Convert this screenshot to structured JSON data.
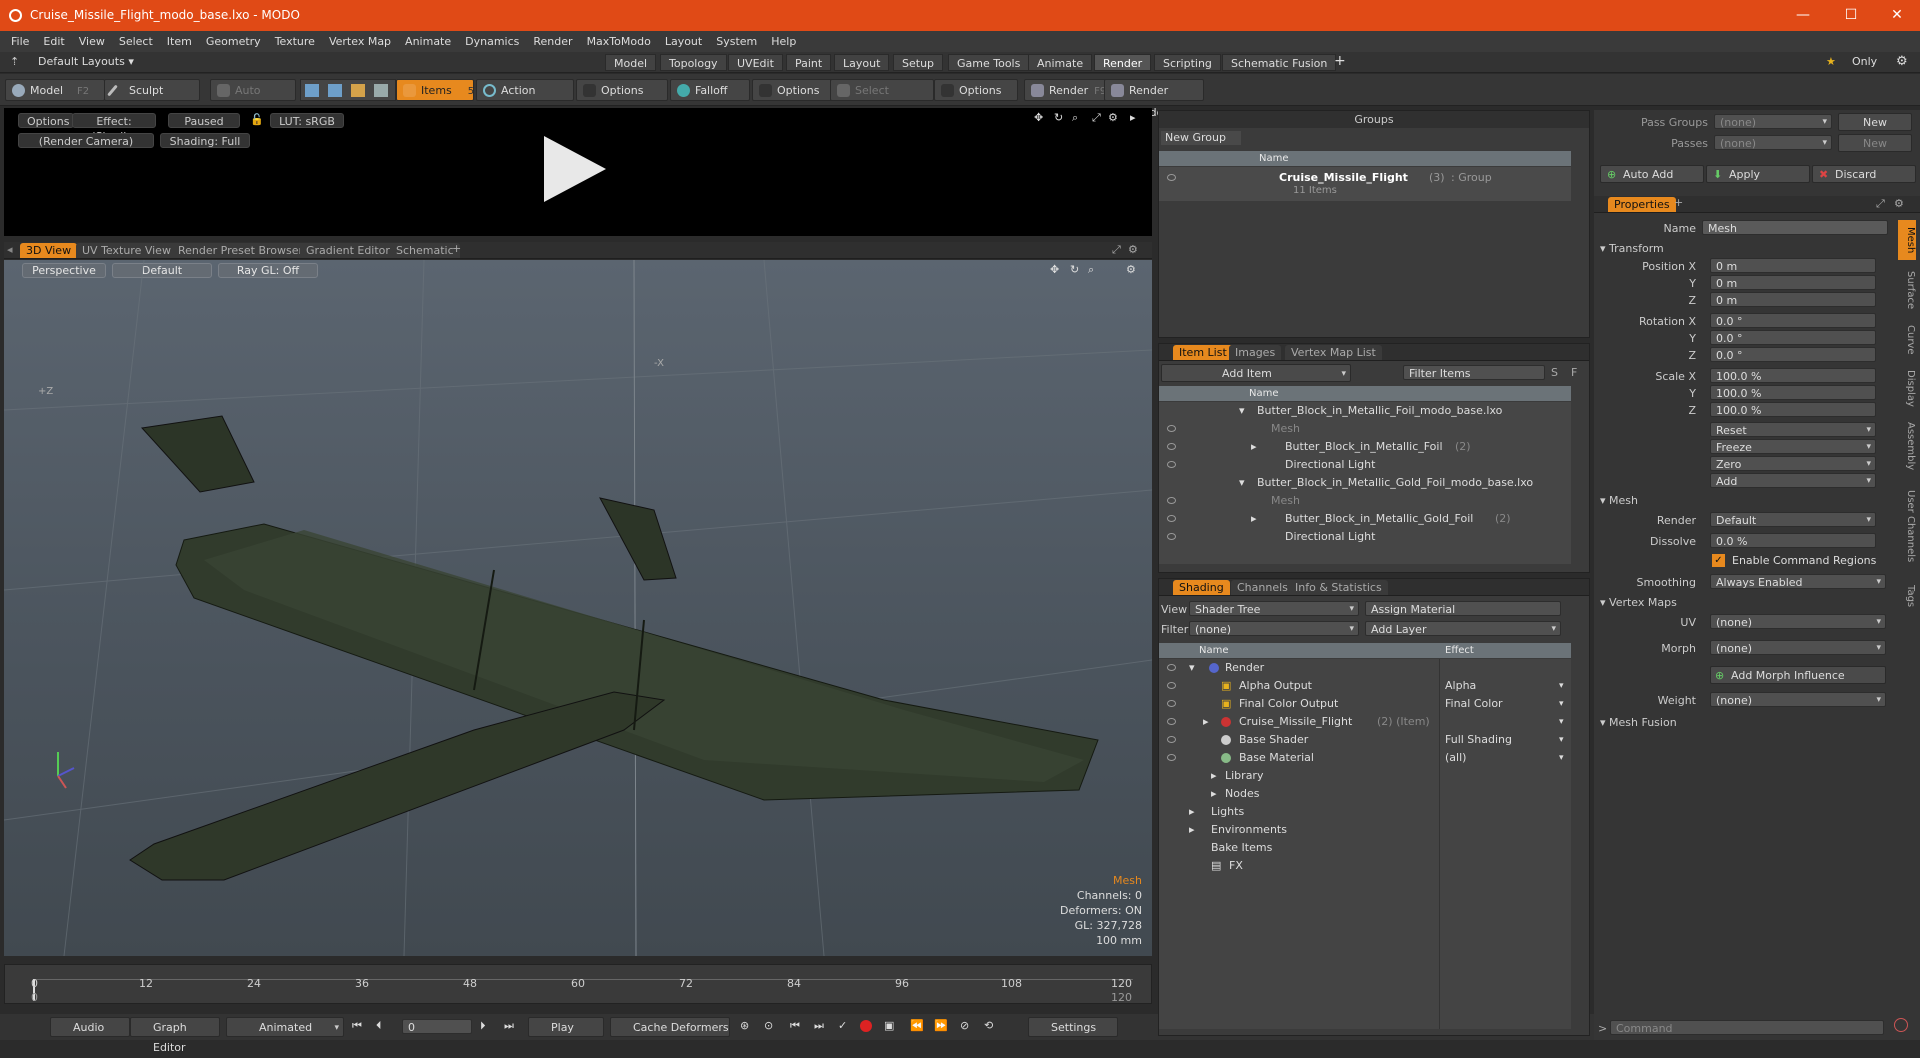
{
  "window": {
    "title": "Cruise_Missile_Flight_modo_base.lxo - MODO",
    "min": "—",
    "max": "☐",
    "close": "✕"
  },
  "menu": [
    "File",
    "Edit",
    "View",
    "Select",
    "Item",
    "Geometry",
    "Texture",
    "Vertex Map",
    "Animate",
    "Dynamics",
    "Render",
    "MaxToModo",
    "Layout",
    "System",
    "Help"
  ],
  "layout": {
    "dropdown": "Default Layouts",
    "tabs": [
      "Model",
      "Topology",
      "UVEdit",
      "Paint",
      "Layout",
      "Setup",
      "Game Tools",
      "Animate",
      "Render",
      "Scripting",
      "Schematic Fusion"
    ],
    "active": "Render",
    "add": "+",
    "only": "Only"
  },
  "toolbar": {
    "model": "Model",
    "model_key": "F2",
    "sculpt": "Sculpt",
    "auto_select": "Auto Select",
    "items": "Items",
    "items_key": "5",
    "action_center": "Action Center",
    "options1": "Options",
    "falloff": "Falloff",
    "options2": "Options",
    "select_through": "Select Through",
    "options3": "Options",
    "render": "Render",
    "render_key": "F9",
    "render_window": "Render Window"
  },
  "preview": {
    "options": "Options",
    "effect": "Effect: (Shadi...",
    "paused": "Paused",
    "lut": "LUT: sRGB",
    "camera": "(Render Camera)",
    "shading": "Shading: Full"
  },
  "viewtabs": [
    "3D View",
    "UV Texture View",
    "Render Preset Browser",
    "Gradient Editor",
    "Schematic"
  ],
  "viewport": {
    "perspective": "Perspective",
    "default": "Default",
    "raygl": "Ray GL: Off",
    "mesh": "Mesh",
    "channels": "Channels: 0",
    "deformers": "Deformers: ON",
    "gl": "GL: 327,728",
    "scale": "100 mm",
    "axis_z": "+Z",
    "axis_x": "-X"
  },
  "timeline": {
    "ticks": [
      "0",
      "12",
      "24",
      "36",
      "48",
      "60",
      "72",
      "84",
      "96",
      "108",
      "120"
    ],
    "end": "120",
    "start": "0"
  },
  "transport": {
    "audio": "Audio",
    "graph_editor": "Graph Editor",
    "animated": "Animated",
    "frame": "0",
    "play": "Play",
    "cache": "Cache Deformers",
    "settings": "Settings"
  },
  "groups": {
    "title": "Groups",
    "new_group": "New Group",
    "col_name": "Name",
    "group_name": "Cruise_Missile_Flight",
    "group_count": "(3)",
    "group_type": ": Group",
    "group_items": "11 Items"
  },
  "itemlist": {
    "tabs": [
      "Item List",
      "Images",
      "Vertex Map List"
    ],
    "add_item": "Add Item",
    "filter": "Filter Items",
    "s": "S",
    "f": "F",
    "col_name": "Name",
    "rows": [
      {
        "label": "Butter_Block_in_Metallic_Foil_modo_base.lxo",
        "extra": ""
      },
      {
        "label": "Mesh",
        "extra": ""
      },
      {
        "label": "Butter_Block_in_Metallic_Foil",
        "extra": "(2)"
      },
      {
        "label": "Directional Light",
        "extra": ""
      },
      {
        "label": "Butter_Block_in_Metallic_Gold_Foil_modo_base.lxo",
        "extra": ""
      },
      {
        "label": "Mesh",
        "extra": ""
      },
      {
        "label": "Butter_Block_in_Metallic_Gold_Foil",
        "extra": "(2)"
      },
      {
        "label": "Directional Light",
        "extra": ""
      }
    ]
  },
  "shading": {
    "tabs": [
      "Shading",
      "Channels",
      "Info & Statistics"
    ],
    "view_label": "View",
    "view": "Shader Tree",
    "assign": "Assign Material",
    "filter_label": "Filter",
    "filter": "(none)",
    "add_layer": "Add Layer",
    "col_name": "Name",
    "col_effect": "Effect",
    "rows": [
      {
        "label": "Render",
        "extra": "",
        "effect": ""
      },
      {
        "label": "Alpha Output",
        "extra": "",
        "effect": "Alpha"
      },
      {
        "label": "Final Color Output",
        "extra": "",
        "effect": "Final Color"
      },
      {
        "label": "Cruise_Missile_Flight",
        "extra": "(2) (Item)",
        "effect": ""
      },
      {
        "label": "Base Shader",
        "extra": "",
        "effect": "Full Shading"
      },
      {
        "label": "Base Material",
        "extra": "",
        "effect": "(all)"
      },
      {
        "label": "Library",
        "extra": "",
        "effect": ""
      },
      {
        "label": "Nodes",
        "extra": "",
        "effect": ""
      },
      {
        "label": "Lights",
        "extra": "",
        "effect": ""
      },
      {
        "label": "Environments",
        "extra": "",
        "effect": ""
      },
      {
        "label": "Bake Items",
        "extra": "",
        "effect": ""
      },
      {
        "label": "FX",
        "extra": "",
        "effect": ""
      }
    ]
  },
  "passes": {
    "pass_groups": "Pass Groups",
    "passes": "Passes",
    "none": "(none)",
    "new": "New",
    "auto_add": "Auto Add",
    "apply": "Apply",
    "discard": "Discard"
  },
  "properties": {
    "title": "Properties",
    "name_label": "Name",
    "name": "Mesh",
    "transform": "Transform",
    "pos_x": "Position X",
    "y": "Y",
    "z": "Z",
    "pos_val": "0 m",
    "rot_x": "Rotation X",
    "rot_val": "0.0 °",
    "scale_x": "Scale X",
    "scale_val": "100.0 %",
    "reset": "Reset",
    "freeze": "Freeze",
    "zero": "Zero",
    "add": "Add",
    "mesh": "Mesh",
    "render_label": "Render",
    "render_val": "Default",
    "dissolve_label": "Dissolve",
    "dissolve_val": "0.0 %",
    "enable_cmd": "Enable Command Regions",
    "smoothing_label": "Smoothing",
    "smoothing_val": "Always Enabled",
    "vertex_maps": "Vertex Maps",
    "uv_label": "UV",
    "morph_label": "Morph",
    "add_morph": "Add Morph Influence",
    "weight_label": "Weight",
    "none": "(none)",
    "mesh_fusion": "Mesh Fusion",
    "side_tabs": [
      "Mesh",
      "Surface",
      "Curve",
      "Display",
      "Assembly",
      "User Channels",
      "Tags"
    ]
  },
  "command": {
    "placeholder": "Command"
  }
}
